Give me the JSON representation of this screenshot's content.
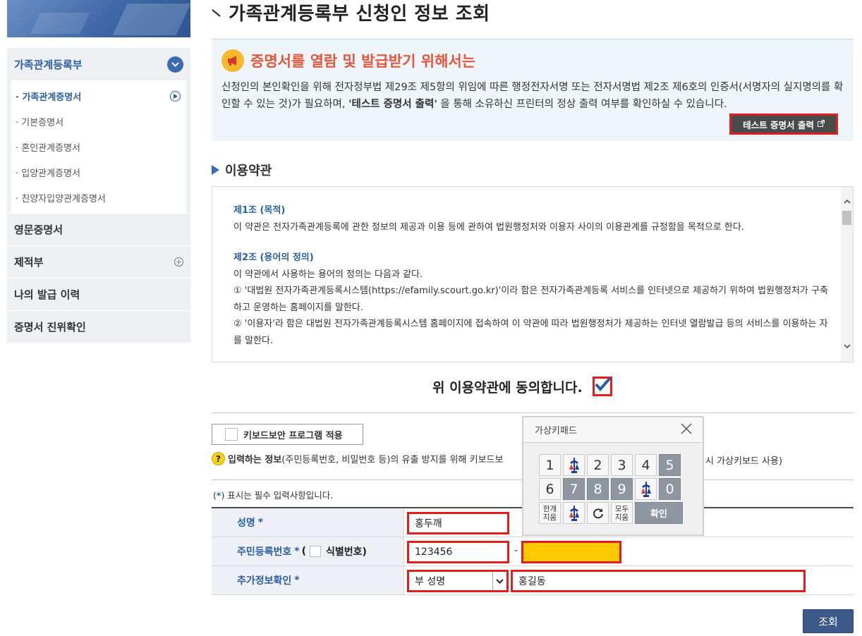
{
  "sidebar": {
    "top_label": "가족관계등록부",
    "sub_items": [
      {
        "label": "· 가족관계증명서"
      },
      {
        "label": "· 기본증명서"
      },
      {
        "label": "· 혼인관계증명서"
      },
      {
        "label": "· 입양관계증명서"
      },
      {
        "label": "· 친양자입양관계증명서"
      }
    ],
    "menu": [
      {
        "label": "영문증명서"
      },
      {
        "label": "제적부"
      },
      {
        "label": "나의 발급 이력"
      },
      {
        "label": "증명서 진위확인"
      }
    ]
  },
  "page": {
    "title": "가족관계등록부 신청인 정보 조회"
  },
  "notice": {
    "title": "증명서를 열람 및 발급받기 위해서는",
    "body_before": "신청인의 본인확인을 위해 전자정부법 제29조 제5항의 위임에 따른 행정전자서명 또는 전자서명법 제2조 제6호의 인증서(서명자의 실지명의를 확인할 수 있는 것)가 필요하며, ",
    "body_bold": "'테스트 증명서 출력'",
    "body_after": " 을 통해 소유하신 프린터의 정상 출력 여부를 확인하실 수 있습니다.",
    "test_button": "테스트 증명서 출력"
  },
  "terms": {
    "section_title": "이용약관",
    "article1_title": "제1조 (목적)",
    "article1_text": "이 약관은 전자가족관계등록에 관한 정보의 제공과 이용 등에 관하여 법원행정처와 이용자 사이의 이용관계를 규정함을 목적으로 한다.",
    "article2_title": "제2조 (용어의 정의)",
    "article2_line1": "이 약관에서 사용하는 용어의 정의는 다음과 같다.",
    "article2_item1": "① '대법원 전자가족관계등록시스템(https://efamily.scourt.go.kr)'이라 함은 전자가족관계등록 서비스를 인터넷으로 제공하기 위하여 법원행정처가 구축하고 운영하는 홈페이지를 말한다.",
    "article2_item2": "② '이용자'라 함은 대법원 전자가족관계등록시스템 홈페이지에 접속하여 이 약관에 따라 법원행정처가 제공하는 인터넷 열람발급 등의 서비스를 이용하는 자를 말한다.",
    "agree_label": "위 이용약관에 동의합니다.",
    "agree_checked": true
  },
  "keyboard": {
    "button_label": "키보드보안 프로그램 적용",
    "note_bold": "입력하는 정보",
    "note_text": "(주민등록번호, 비밀번호 등)의 유출 방지를 위해 키보드보",
    "note_tail": "시 가상키보드 사용)"
  },
  "form": {
    "required_note_prefix": "(",
    "required_note_star": "*",
    "required_note_suffix": ") 표시는 필수 입력사항입니다.",
    "name_label": "성명",
    "name_value": "홍두깨",
    "rrn_label": "주민등록번호",
    "rrn_paren_open": "(",
    "rrn_id_label": "식별번호)",
    "rrn_front": "123456",
    "rrn_dash": "-",
    "rrn_back": "",
    "extra_label": "추가정보확인",
    "extra_select": "부 성명",
    "extra_value": "홍길동",
    "star": "*",
    "search_button": "조회"
  },
  "keypad": {
    "title": "가상키패드",
    "row1": [
      "1",
      "",
      "2",
      "3",
      "4",
      "5"
    ],
    "row2": [
      "6",
      "7",
      "8",
      "9",
      "",
      "0"
    ],
    "clear_one": "한개\n지움",
    "clear_all": "모두\n지움",
    "confirm": "확인"
  },
  "colors": {
    "brand_blue": "#2a5fa3",
    "highlight_red": "#e01f1f",
    "notice_title": "#e4563a",
    "rrn_back_fill": "#ffc800"
  }
}
